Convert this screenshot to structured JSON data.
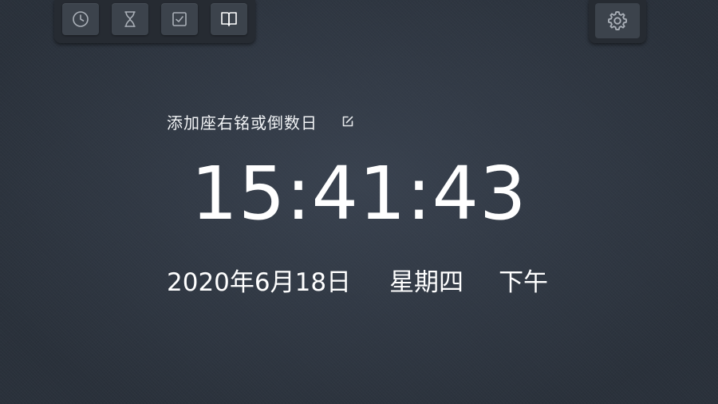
{
  "toolbar": {
    "buttons": [
      {
        "icon": "clock-icon",
        "name": "clock-tab-button",
        "active": false
      },
      {
        "icon": "hourglass-icon",
        "name": "timer-tab-button",
        "active": false
      },
      {
        "icon": "checkbox-icon",
        "name": "todo-tab-button",
        "active": false
      },
      {
        "icon": "book-icon",
        "name": "reading-tab-button",
        "active": true
      }
    ],
    "settings_icon": "gear-icon"
  },
  "motto": {
    "text": "添加座右铭或倒数日",
    "edit_icon": "edit-icon"
  },
  "clock": {
    "time": "15:41:43",
    "date": "2020年6月18日",
    "weekday": "星期四",
    "ampm": "下午"
  },
  "colors": {
    "background": "#2a313b",
    "panel": "#262b32",
    "button": "#3c434c",
    "text": "#ffffff",
    "icon": "#aab0b8"
  }
}
